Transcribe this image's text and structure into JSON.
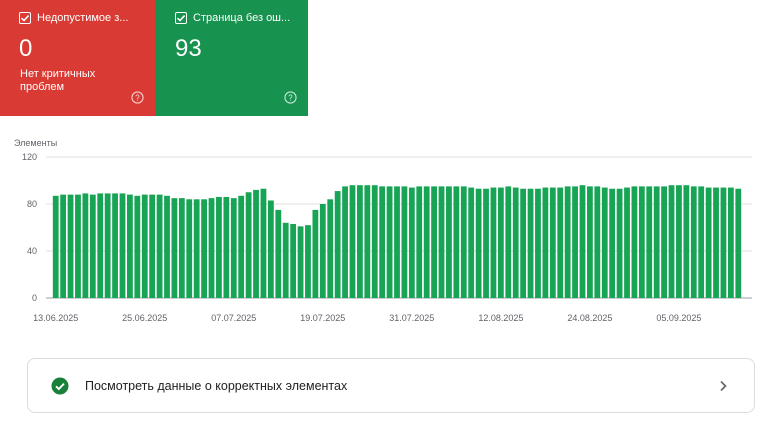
{
  "cards": [
    {
      "title": "Недопустимое з...",
      "value": "0",
      "description": "Нет критичных проблем",
      "color": "#d93b34",
      "checkbox": "checkbox-checked-icon",
      "help": "help-icon"
    },
    {
      "title": "Страница без ош...",
      "value": "93",
      "description": "",
      "color": "#17924f",
      "checkbox": "checkbox-checked-icon",
      "help": "help-icon"
    }
  ],
  "chart_data": {
    "type": "bar",
    "ylabel": "Элементы",
    "ylim": [
      0,
      120
    ],
    "yticks": [
      0,
      40,
      80,
      120
    ],
    "bar_color": "#17a455",
    "xtick_labels": [
      "13.06.2025",
      "25.06.2025",
      "07.07.2025",
      "19.07.2025",
      "31.07.2025",
      "12.08.2025",
      "24.08.2025",
      "05.09.2025"
    ],
    "xtick_indices": [
      0,
      12,
      24,
      36,
      48,
      60,
      72,
      84
    ],
    "values": [
      87,
      88,
      88,
      88,
      89,
      88,
      89,
      89,
      89,
      89,
      88,
      87,
      88,
      88,
      88,
      87,
      85,
      85,
      84,
      84,
      84,
      85,
      86,
      86,
      85,
      87,
      90,
      92,
      93,
      83,
      75,
      64,
      63,
      61,
      62,
      75,
      80,
      84,
      91,
      95,
      96,
      96,
      96,
      96,
      95,
      95,
      95,
      95,
      94,
      95,
      95,
      95,
      95,
      95,
      95,
      95,
      94,
      93,
      93,
      94,
      94,
      95,
      94,
      93,
      93,
      93,
      94,
      94,
      94,
      95,
      95,
      96,
      95,
      95,
      94,
      93,
      93,
      94,
      95,
      95,
      95,
      95,
      95,
      96,
      96,
      96,
      95,
      95,
      94,
      94,
      94,
      94,
      93
    ]
  },
  "bottom_row": {
    "label": "Посмотреть данные о корректных элементах",
    "status_icon": "check-circle-icon",
    "status_color": "#188038",
    "action_icon": "chevron-right-icon"
  }
}
